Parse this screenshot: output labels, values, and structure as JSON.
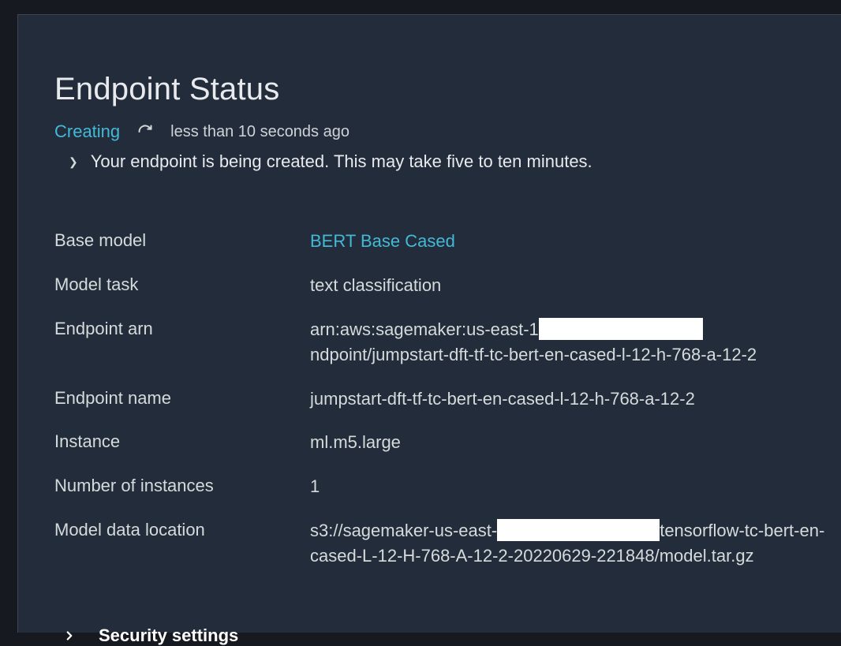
{
  "title": "Endpoint Status",
  "status": {
    "state": "Creating",
    "lastRefresh": "less than 10 seconds ago",
    "message": "Your endpoint is being created. This may take five to ten minutes."
  },
  "details": {
    "baseModel": {
      "label": "Base model",
      "value": "BERT Base Cased"
    },
    "modelTask": {
      "label": "Model task",
      "value": "text classification"
    },
    "endpointArn": {
      "label": "Endpoint arn",
      "prefix": "arn:aws:sagemaker:us-east-1",
      "suffix": "ndpoint/jumpstart-dft-tf-tc-bert-en-cased-l-12-h-768-a-12-2"
    },
    "endpointName": {
      "label": "Endpoint name",
      "value": "jumpstart-dft-tf-tc-bert-en-cased-l-12-h-768-a-12-2"
    },
    "instance": {
      "label": "Instance",
      "value": "ml.m5.large"
    },
    "numInstances": {
      "label": "Number of instances",
      "value": "1"
    },
    "modelDataLocation": {
      "label": "Model data location",
      "prefix": "s3://sagemaker-us-east-",
      "suffix": "tensorflow-tc-bert-en-cased-L-12-H-768-A-12-2-20220629-221848/model.tar.gz"
    }
  },
  "security": {
    "label": "Security settings"
  }
}
